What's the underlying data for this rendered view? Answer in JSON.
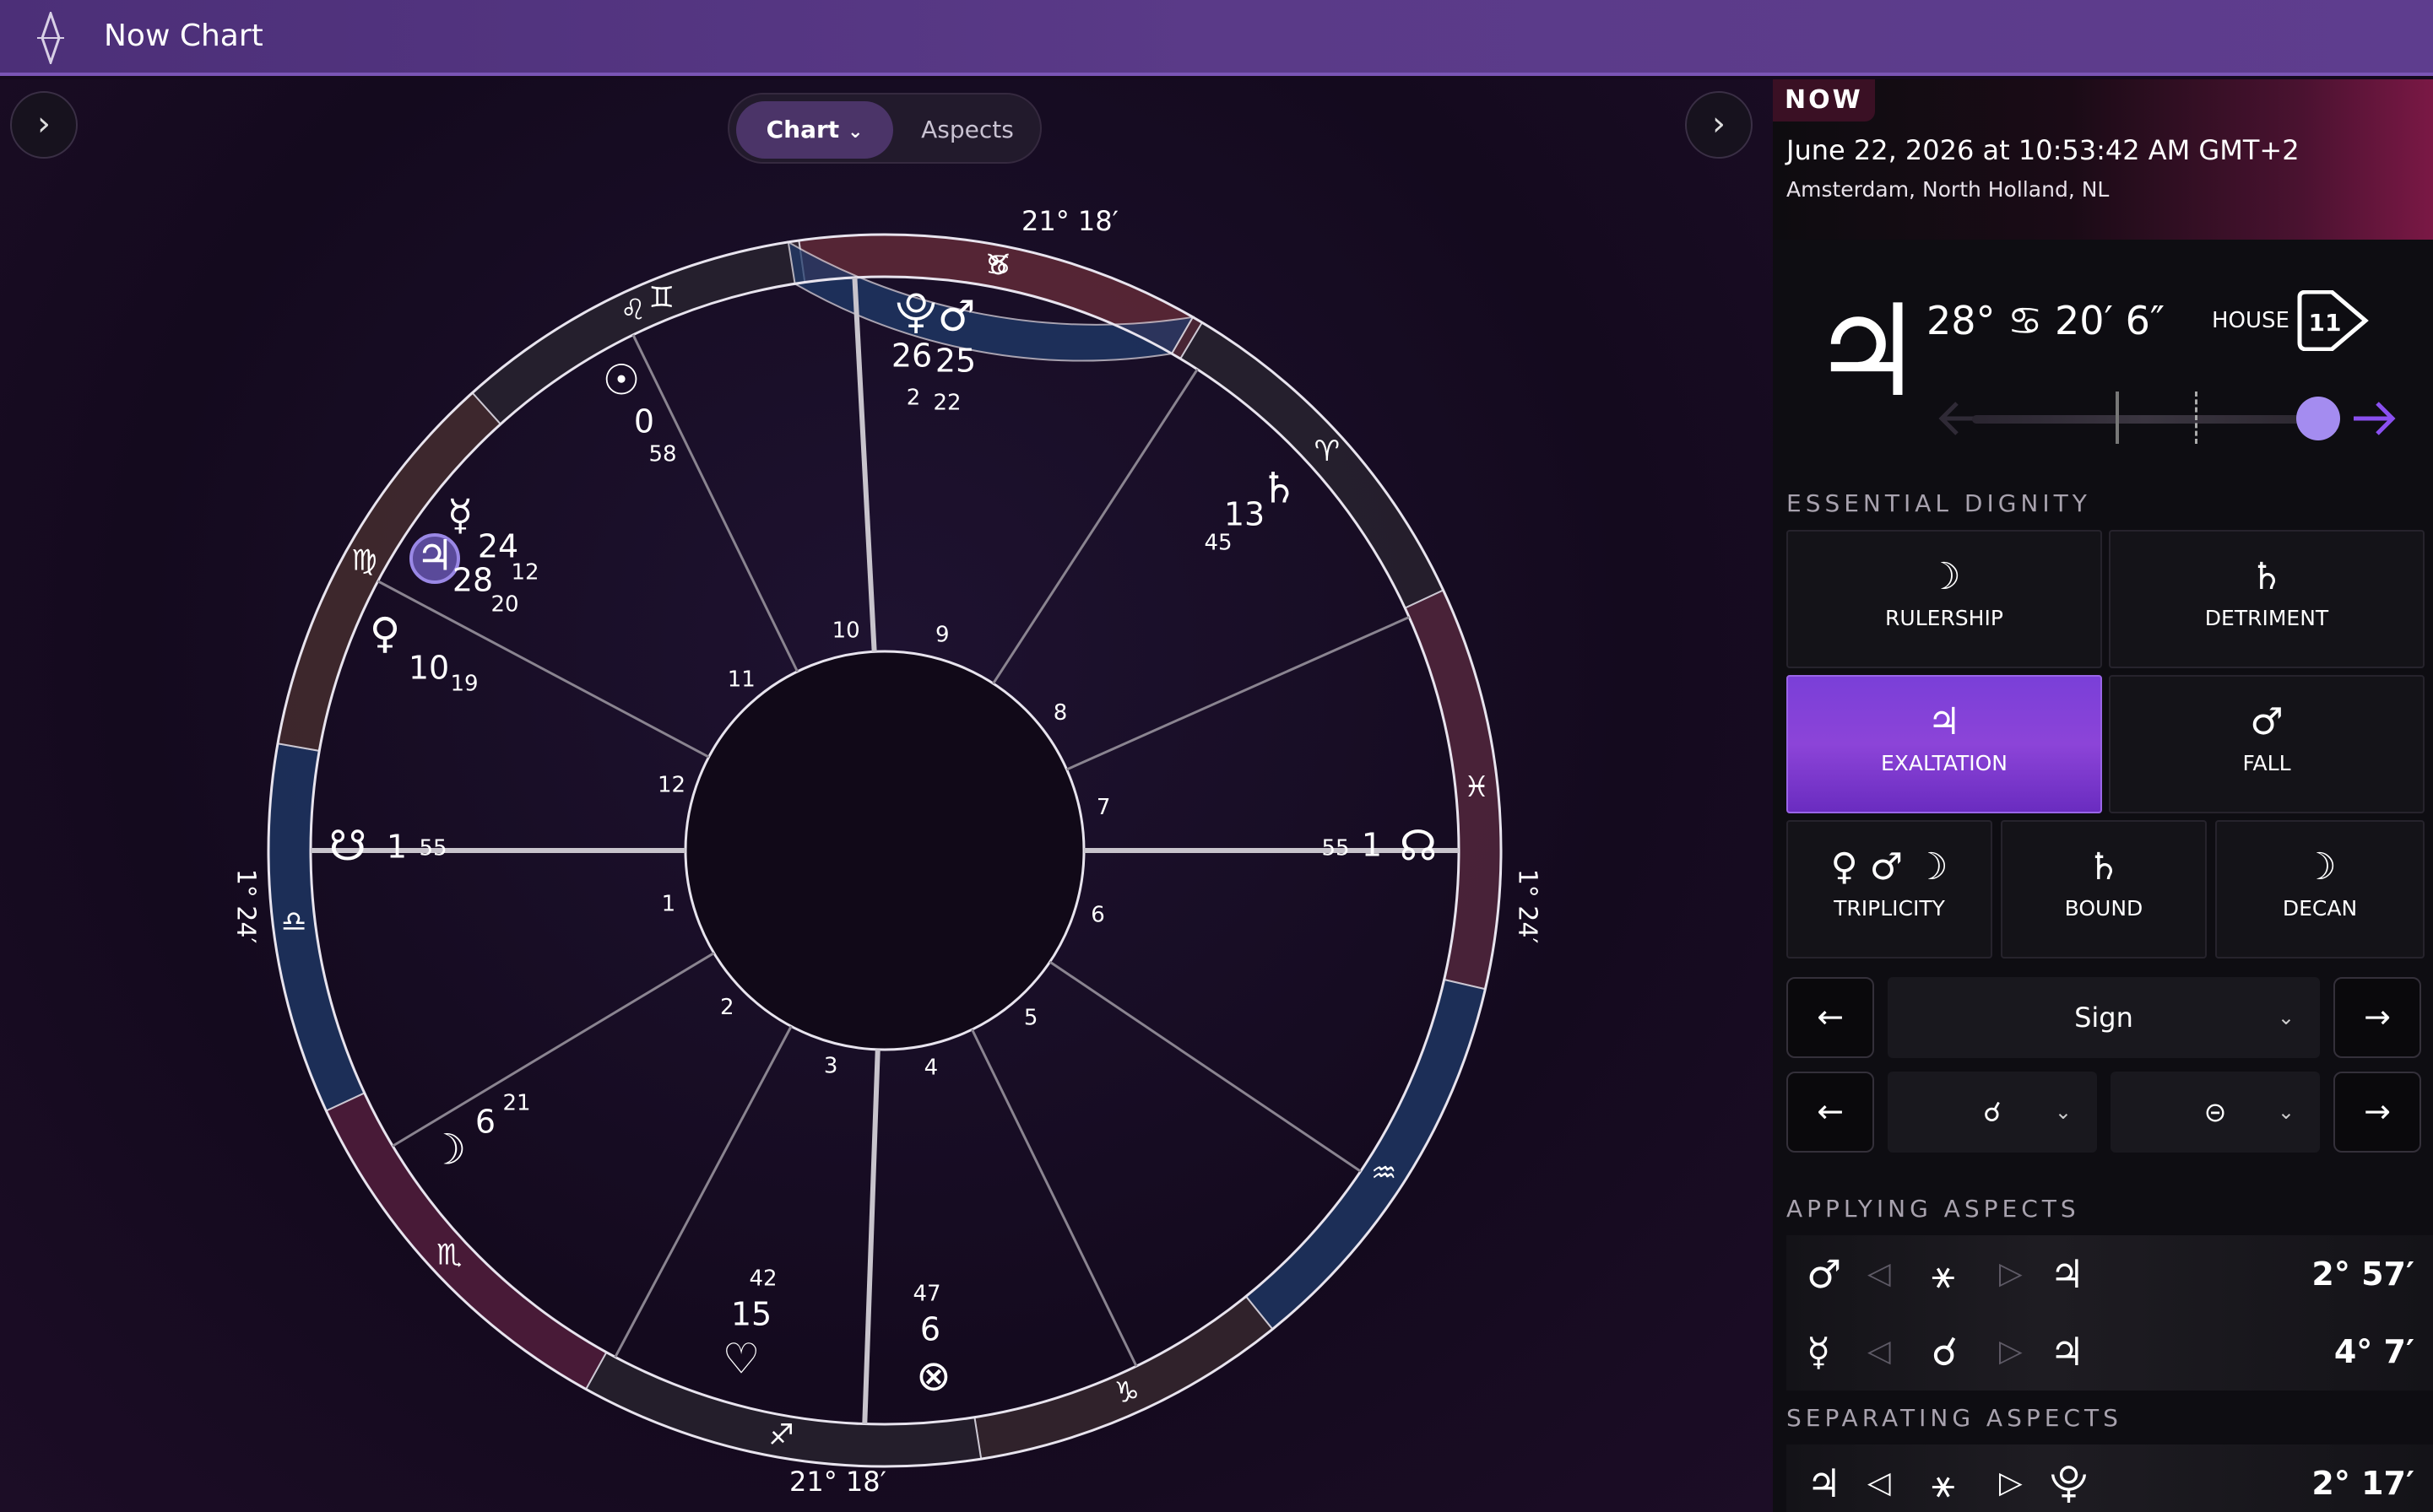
{
  "app": {
    "title": "Now Chart"
  },
  "toolbar": {
    "chart_label": "Chart",
    "aspects_label": "Aspects",
    "chevron": "⌄",
    "left_arrow": "›",
    "right_arrow": "›"
  },
  "wheel": {
    "angles": {
      "top": "21° 18′",
      "bottom": "21° 18′",
      "left": "1° 24′",
      "right": "1° 24′"
    },
    "signs": [
      "♊",
      "♉",
      "♈",
      "♓",
      "♒",
      "♑",
      "♐",
      "♏",
      "♎",
      "♍",
      "♌",
      "♋"
    ],
    "houses": [
      "1",
      "2",
      "3",
      "4",
      "5",
      "6",
      "7",
      "8",
      "9",
      "10",
      "11",
      "12"
    ],
    "planets": [
      {
        "id": "pluto",
        "glyph": "⯓",
        "deg": "26",
        "min": "2"
      },
      {
        "id": "mars",
        "glyph": "♂",
        "deg": "25",
        "min": "22"
      },
      {
        "id": "sun",
        "glyph": "☉",
        "deg": "0",
        "min": "58"
      },
      {
        "id": "mercury",
        "glyph": "☿",
        "deg": "24",
        "min": "12"
      },
      {
        "id": "jupiter",
        "glyph": "♃",
        "deg": "28",
        "min": "20"
      },
      {
        "id": "venus",
        "glyph": "♀",
        "deg": "10",
        "min": "19"
      },
      {
        "id": "saturn",
        "glyph": "♄",
        "deg": "13",
        "min": "45"
      },
      {
        "id": "south-node",
        "glyph": "☋",
        "deg": "1",
        "min": "55"
      },
      {
        "id": "north-node",
        "glyph": "☊",
        "deg": "1",
        "min": "55"
      },
      {
        "id": "moon",
        "glyph": "☽",
        "deg": "6",
        "min": "21"
      },
      {
        "id": "vertex",
        "glyph": "♡",
        "deg": "15",
        "min": "42"
      },
      {
        "id": "part-of-fortune",
        "glyph": "⊗",
        "deg": "6",
        "min": "47"
      }
    ]
  },
  "now": {
    "badge": "NOW",
    "date": "June 22, 2026 at 10:53:42 AM GMT+2",
    "place": "Amsterdam, North Holland, NL"
  },
  "planet": {
    "glyph": "♃",
    "position": "28° ♋ 20′ 6″",
    "house_label": "HOUSE",
    "house": "11"
  },
  "dignity": {
    "title": "ESSENTIAL DIGNITY",
    "rulership": {
      "glyph": "☽",
      "label": "RULERSHIP"
    },
    "detriment": {
      "glyph": "♄",
      "label": "DETRIMENT"
    },
    "exaltation": {
      "glyph": "♃",
      "label": "EXALTATION"
    },
    "fall": {
      "glyph": "♂",
      "label": "FALL"
    },
    "triplicity": {
      "glyph": "♀ ♂ ☽",
      "label": "TRIPLICITY"
    },
    "bound": {
      "glyph": "♄",
      "label": "BOUND"
    },
    "decan": {
      "glyph": "☽",
      "label": "DECAN"
    }
  },
  "controls": {
    "prev": "←",
    "next": "→",
    "sign_select": "Sign",
    "aspect_select": "☌",
    "target_select": "⊝",
    "chevron": "⌄"
  },
  "applying": {
    "title": "APPLYING ASPECTS",
    "rows": [
      {
        "p1": "♂",
        "aspect": "⚹",
        "p2": "♃",
        "value": "2° 57′"
      },
      {
        "p1": "☿",
        "aspect": "☌",
        "p2": "♃",
        "value": "4° 7′"
      }
    ],
    "left_ind": "◁",
    "right_ind": "▷"
  },
  "separating": {
    "title": "SEPARATING ASPECTS",
    "rows": [
      {
        "p1": "♃",
        "aspect": "⚹",
        "p2": "⯓",
        "value": "2° 17′"
      }
    ],
    "left_ind": "◁",
    "right_ind": "▷"
  },
  "colors": {
    "accent": "#8c44d8",
    "knob": "#a48cf0",
    "arrow": "#8a50f0"
  }
}
